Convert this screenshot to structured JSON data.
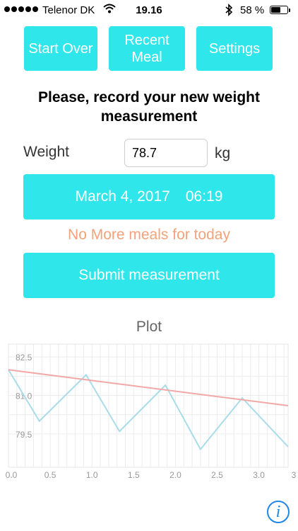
{
  "status_bar": {
    "carrier": "Telenor DK",
    "time": "19.16",
    "battery": "58 %",
    "battery_level": 0.58
  },
  "toolbar": {
    "start_over_label": "Start Over",
    "recent_meal_label": "Recent Meal",
    "settings_label": "Settings"
  },
  "main": {
    "heading": "Please, record your new weight measurement",
    "weight_label": "Weight",
    "weight_value": "78.7",
    "weight_unit": "kg",
    "date": "March 4, 2017",
    "time": "06:19",
    "warning": "No More meals for today",
    "submit_label": "Submit measurement",
    "accent_color": "#2fe6ea",
    "warning_color": "#f4a27a"
  },
  "plot": {
    "title": "Plot",
    "info_icon": "info-icon"
  },
  "chart_data": {
    "type": "line",
    "title": "Plot",
    "xlim": [
      0,
      3.35
    ],
    "ylim": [
      78.2,
      83.0
    ],
    "y_ticks": [
      "82.5",
      "81.0",
      "79.5"
    ],
    "x_ticks": [
      "0.0",
      "0.5",
      "1.0",
      "1.5",
      "2.0",
      "2.5",
      "3.0",
      "3"
    ],
    "grid": true,
    "series": [
      {
        "color": "#a9dce9",
        "points": [
          [
            0,
            82.0
          ],
          [
            0.37,
            80.0
          ],
          [
            0.93,
            81.8
          ],
          [
            1.33,
            79.6
          ],
          [
            1.88,
            81.4
          ],
          [
            2.3,
            78.9
          ],
          [
            2.8,
            80.9
          ],
          [
            3.35,
            79.0
          ]
        ]
      },
      {
        "color": "#f2a8a6",
        "points": [
          [
            0,
            82.0
          ],
          [
            3.35,
            80.6
          ]
        ]
      }
    ]
  }
}
